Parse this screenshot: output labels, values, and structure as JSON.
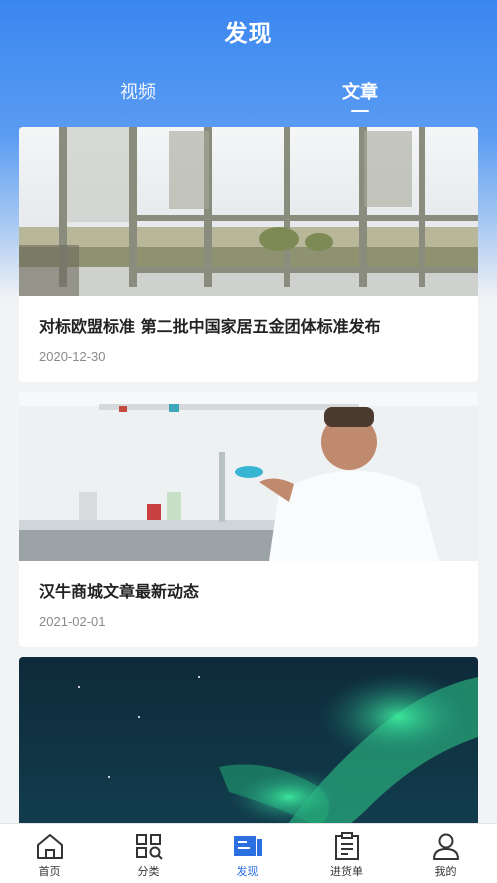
{
  "header": {
    "title": "发现"
  },
  "tabs": [
    {
      "label": "视频",
      "active": false
    },
    {
      "label": "文章",
      "active": true
    }
  ],
  "articles": [
    {
      "title": "对标欧盟标准 第二批中国家居五金团体标准发布",
      "date": "2020-12-30",
      "image": "window-room-photo"
    },
    {
      "title": "汉牛商城文章最新动态",
      "date": "2021-02-01",
      "image": "lab-scientist-photo"
    },
    {
      "title": "",
      "date": "",
      "image": "aurora-photo"
    }
  ],
  "tabbar": [
    {
      "label": "首页",
      "icon": "home-icon",
      "active": false
    },
    {
      "label": "分类",
      "icon": "category-icon",
      "active": false
    },
    {
      "label": "发现",
      "icon": "discover-icon",
      "active": true
    },
    {
      "label": "进货单",
      "icon": "order-list-icon",
      "active": false
    },
    {
      "label": "我的",
      "icon": "profile-icon",
      "active": false
    }
  ],
  "colors": {
    "accent": "#2b6fe0",
    "header_top": "#3a86f0",
    "background": "#f2f3f5"
  }
}
